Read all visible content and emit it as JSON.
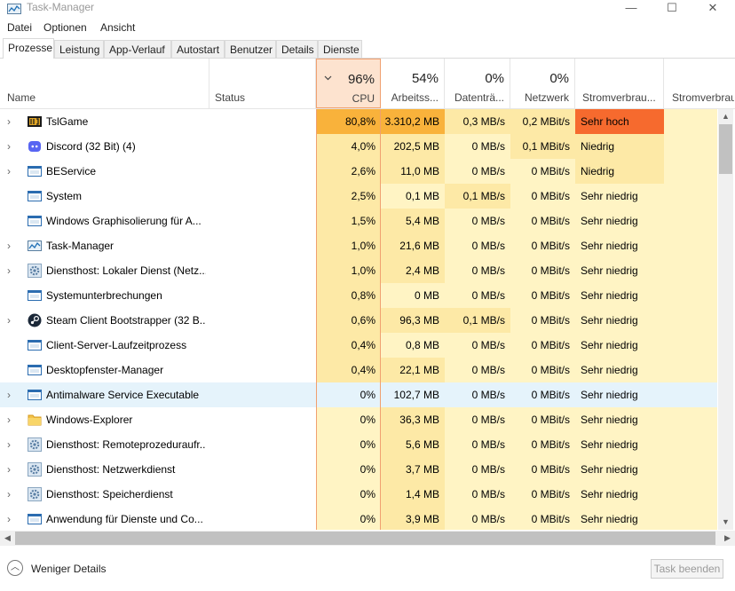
{
  "window": {
    "title": "Task-Manager"
  },
  "menu": [
    "Datei",
    "Optionen",
    "Ansicht"
  ],
  "tabs": [
    "Prozesse",
    "Leistung",
    "App-Verlauf",
    "Autostart",
    "Benutzer",
    "Details",
    "Dienste"
  ],
  "active_tab": "Prozesse",
  "columns": {
    "name": "Name",
    "status": "Status",
    "cpu": {
      "pct": "96%",
      "label": "CPU"
    },
    "memory": {
      "pct": "54%",
      "label": "Arbeitss..."
    },
    "disk": {
      "pct": "0%",
      "label": "Datenträ..."
    },
    "network": {
      "pct": "0%",
      "label": "Netzwerk"
    },
    "power": "Stromverbrau...",
    "power_trend": "Stromverbrau"
  },
  "processes": [
    {
      "name": "TslGame",
      "expandable": true,
      "icon": "pubg-game-icon",
      "cpu": "80,8%",
      "mem": "3.310,2 MB",
      "disk": "0,3 MB/s",
      "net": "0,2 MBit/s",
      "power": "Sehr hoch",
      "selected": false
    },
    {
      "name": "Discord (32 Bit) (4)",
      "expandable": true,
      "icon": "discord-icon",
      "cpu": "4,0%",
      "mem": "202,5 MB",
      "disk": "0 MB/s",
      "net": "0,1 MBit/s",
      "power": "Niedrig",
      "selected": false
    },
    {
      "name": "BEService",
      "expandable": true,
      "icon": "window-app-icon",
      "cpu": "2,6%",
      "mem": "11,0 MB",
      "disk": "0 MB/s",
      "net": "0 MBit/s",
      "power": "Niedrig",
      "selected": false
    },
    {
      "name": "System",
      "expandable": false,
      "icon": "window-app-icon",
      "cpu": "2,5%",
      "mem": "0,1 MB",
      "disk": "0,1 MB/s",
      "net": "0 MBit/s",
      "power": "Sehr niedrig",
      "selected": false
    },
    {
      "name": "Windows Graphisolierung für A...",
      "expandable": false,
      "icon": "window-app-icon",
      "cpu": "1,5%",
      "mem": "5,4 MB",
      "disk": "0 MB/s",
      "net": "0 MBit/s",
      "power": "Sehr niedrig",
      "selected": false
    },
    {
      "name": "Task-Manager",
      "expandable": true,
      "icon": "task-manager-icon",
      "cpu": "1,0%",
      "mem": "21,6 MB",
      "disk": "0 MB/s",
      "net": "0 MBit/s",
      "power": "Sehr niedrig",
      "selected": false
    },
    {
      "name": "Diensthost: Lokaler Dienst (Netz...",
      "expandable": true,
      "icon": "gear-icon",
      "cpu": "1,0%",
      "mem": "2,4 MB",
      "disk": "0 MB/s",
      "net": "0 MBit/s",
      "power": "Sehr niedrig",
      "selected": false
    },
    {
      "name": "Systemunterbrechungen",
      "expandable": false,
      "icon": "window-app-icon",
      "cpu": "0,8%",
      "mem": "0 MB",
      "disk": "0 MB/s",
      "net": "0 MBit/s",
      "power": "Sehr niedrig",
      "selected": false
    },
    {
      "name": "Steam Client Bootstrapper (32 B...",
      "expandable": true,
      "icon": "steam-icon",
      "cpu": "0,6%",
      "mem": "96,3 MB",
      "disk": "0,1 MB/s",
      "net": "0 MBit/s",
      "power": "Sehr niedrig",
      "selected": false
    },
    {
      "name": "Client-Server-Laufzeitprozess",
      "expandable": false,
      "icon": "window-app-icon",
      "cpu": "0,4%",
      "mem": "0,8 MB",
      "disk": "0 MB/s",
      "net": "0 MBit/s",
      "power": "Sehr niedrig",
      "selected": false
    },
    {
      "name": "Desktopfenster-Manager",
      "expandable": false,
      "icon": "window-app-icon",
      "cpu": "0,4%",
      "mem": "22,1 MB",
      "disk": "0 MB/s",
      "net": "0 MBit/s",
      "power": "Sehr niedrig",
      "selected": false
    },
    {
      "name": "Antimalware Service Executable",
      "expandable": true,
      "icon": "window-app-icon",
      "cpu": "0%",
      "mem": "102,7 MB",
      "disk": "0 MB/s",
      "net": "0 MBit/s",
      "power": "Sehr niedrig",
      "selected": true
    },
    {
      "name": "Windows-Explorer",
      "expandable": true,
      "icon": "folder-icon",
      "cpu": "0%",
      "mem": "36,3 MB",
      "disk": "0 MB/s",
      "net": "0 MBit/s",
      "power": "Sehr niedrig",
      "selected": false
    },
    {
      "name": "Diensthost: Remoteprozeduraufr...",
      "expandable": true,
      "icon": "gear-icon",
      "cpu": "0%",
      "mem": "5,6 MB",
      "disk": "0 MB/s",
      "net": "0 MBit/s",
      "power": "Sehr niedrig",
      "selected": false
    },
    {
      "name": "Diensthost: Netzwerkdienst",
      "expandable": true,
      "icon": "gear-icon",
      "cpu": "0%",
      "mem": "3,7 MB",
      "disk": "0 MB/s",
      "net": "0 MBit/s",
      "power": "Sehr niedrig",
      "selected": false
    },
    {
      "name": "Diensthost: Speicherdienst",
      "expandable": true,
      "icon": "gear-icon",
      "cpu": "0%",
      "mem": "1,4 MB",
      "disk": "0 MB/s",
      "net": "0 MBit/s",
      "power": "Sehr niedrig",
      "selected": false
    },
    {
      "name": "Anwendung für Dienste und Co...",
      "expandable": true,
      "icon": "window-app-icon",
      "cpu": "0%",
      "mem": "3,9 MB",
      "disk": "0 MB/s",
      "net": "0 MBit/s",
      "power": "Sehr niedrig",
      "selected": false
    }
  ],
  "footer": {
    "fewer_details": "Weniger Details",
    "end_task": "Task beenden"
  },
  "colors": {
    "heat_light": "#fff4c4",
    "heat_mid": "#fde9a6",
    "heat_high": "#f9b23b",
    "power_very_high": "#f66a2e",
    "selection": "#e5f3fb",
    "cpu_header_border": "#f0a070"
  }
}
